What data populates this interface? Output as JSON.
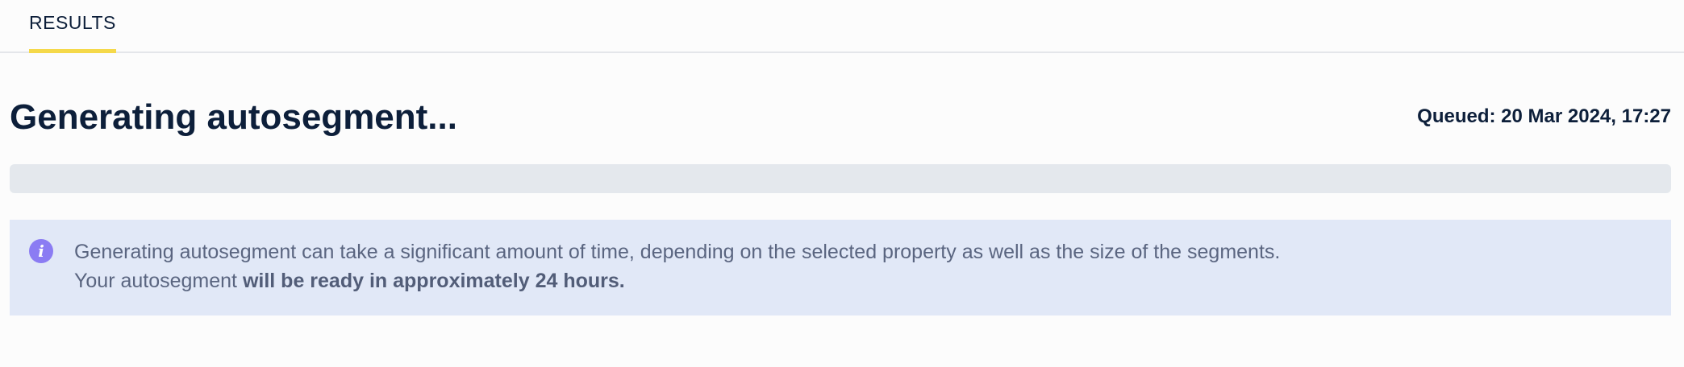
{
  "tabs": [
    {
      "label": "RESULTS",
      "active": true
    }
  ],
  "page": {
    "title": "Generating autosegment...",
    "queued": "Queued: 20 Mar 2024, 17:27"
  },
  "progress": {
    "fraction": 0
  },
  "info": {
    "icon": "info-icon",
    "line1": "Generating autosegment can take a significant amount of time, depending on the selected property as well as the size of the segments.",
    "line2_prefix": "Your autosegment ",
    "line2_bold": "will be ready in approximately 24 hours."
  },
  "colors": {
    "tab_indicator": "#f5d94a",
    "info_background": "#e1e8f7",
    "info_icon": "#8b7cf3",
    "progress_track": "#e4e8ed"
  }
}
